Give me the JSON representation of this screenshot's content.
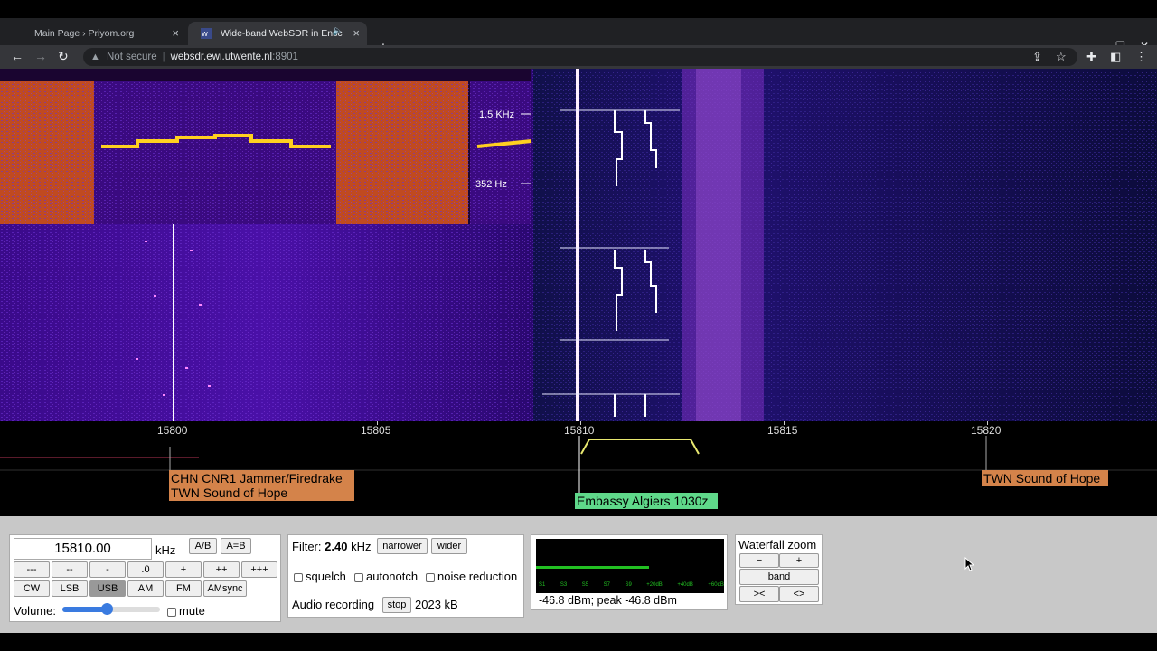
{
  "browser": {
    "tabs": [
      {
        "title": "Main Page › Priyom.org",
        "close": "×"
      },
      {
        "title": "Wide-band WebSDR in Ensc",
        "close": "×",
        "audio_icon": "speaker-icon"
      }
    ],
    "new_tab": "+",
    "window_controls": {
      "dropdown": "⌄",
      "minimize": "–",
      "restore": "❐",
      "close": "✕"
    },
    "nav": {
      "back": "←",
      "forward": "→",
      "reload": "↻"
    },
    "address": {
      "security": "Not secure",
      "host": "websdr.ewi.utwente.nl",
      "port": ":8901"
    },
    "toolbar_icons": [
      "share-icon",
      "star-icon",
      "extensions-icon",
      "sidepanel-icon",
      "menu-icon"
    ]
  },
  "waterfall": {
    "audio_scale_labels": [
      "1.5 KHz",
      "352 Hz"
    ]
  },
  "frequency_scale": {
    "ticks": [
      "15800",
      "15805",
      "15810",
      "15815",
      "15820"
    ],
    "labels": [
      {
        "text_line1": "CHN CNR1 Jammer/Firedrake",
        "text_line2": "TWN Sound of Hope",
        "color": "#d4834a"
      },
      {
        "text_line1": "Embassy Algiers 1030z",
        "color": "#5fd88a"
      },
      {
        "text_line1": "TWN Sound of Hope",
        "color": "#d4834a"
      }
    ]
  },
  "tuning": {
    "frequency": "15810.00",
    "unit": "kHz",
    "ab": "A/B",
    "a_eq_b": "A=B",
    "step_buttons": [
      "---",
      "--",
      "-",
      ".0",
      "+",
      "++",
      "+++"
    ],
    "modes": [
      "CW",
      "LSB",
      "USB",
      "AM",
      "FM",
      "AMsync"
    ],
    "active_mode": "USB",
    "volume_label": "Volume:",
    "volume_level": 0.45,
    "mute_label": "mute"
  },
  "filter": {
    "label": "Filter:",
    "value": "2.40",
    "unit": "kHz",
    "narrower": "narrower",
    "wider": "wider",
    "squelch": "squelch",
    "autonotch": "autonotch",
    "noise_reduction": "noise reduction",
    "recording_label": "Audio recording",
    "stop": "stop",
    "recording_size": "2023 kB"
  },
  "smeter": {
    "scale": [
      "S1",
      "S3",
      "S5",
      "S7",
      "S9",
      "+20dB",
      "+40dB",
      "+60dB"
    ],
    "level": 0.6,
    "readout": "-46.8 dBm; peak  -46.8 dBm"
  },
  "zoom": {
    "title": "Waterfall zoom",
    "minus": "−",
    "plus": "+",
    "band": "band",
    "narrow": "><",
    "wide": "<>"
  },
  "colors": {
    "label_orange": "#d4834a",
    "label_green": "#5fd88a",
    "smeter_bar": "#22c022"
  }
}
